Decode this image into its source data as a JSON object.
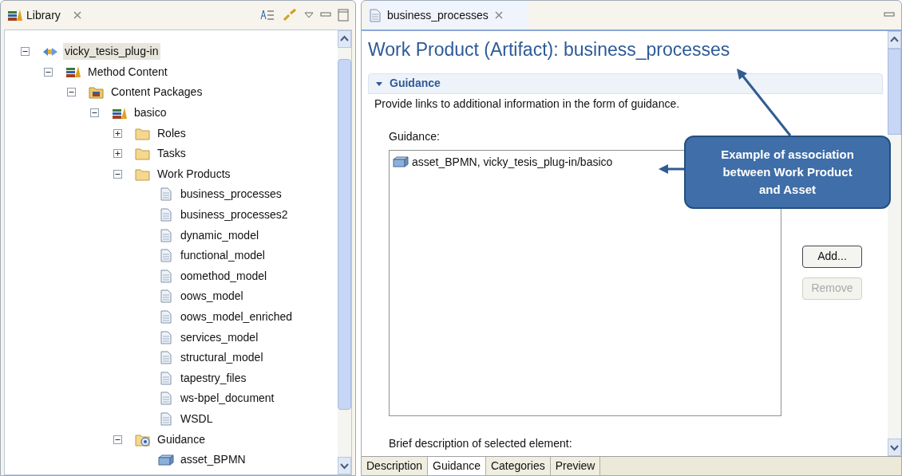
{
  "library_view": {
    "title": "Library",
    "tree": [
      {
        "label": "vicky_tesis_plug-in",
        "kind": "plugin",
        "expanded": true,
        "selected": true,
        "children": [
          {
            "label": "Method Content",
            "kind": "library",
            "expanded": true,
            "selected": false,
            "children": [
              {
                "label": "Content Packages",
                "kind": "package",
                "expanded": true,
                "selected": false,
                "children": [
                  {
                    "label": "basico",
                    "kind": "library",
                    "expanded": true,
                    "selected": false,
                    "children": [
                      {
                        "label": "Roles",
                        "kind": "folder",
                        "expanded": false,
                        "selected": false
                      },
                      {
                        "label": "Tasks",
                        "kind": "folder",
                        "expanded": false,
                        "selected": false
                      },
                      {
                        "label": "Work Products",
                        "kind": "folder",
                        "expanded": true,
                        "selected": false,
                        "children": [
                          {
                            "label": "business_processes",
                            "kind": "document",
                            "selected": false
                          },
                          {
                            "label": "business_processes2",
                            "kind": "document",
                            "selected": false
                          },
                          {
                            "label": "dynamic_model",
                            "kind": "document",
                            "selected": false
                          },
                          {
                            "label": "functional_model",
                            "kind": "document",
                            "selected": false
                          },
                          {
                            "label": "oomethod_model",
                            "kind": "document",
                            "selected": false
                          },
                          {
                            "label": "oows_model",
                            "kind": "document",
                            "selected": false
                          },
                          {
                            "label": "oows_model_enriched",
                            "kind": "document",
                            "selected": false
                          },
                          {
                            "label": "services_model",
                            "kind": "document",
                            "selected": false
                          },
                          {
                            "label": "structural_model",
                            "kind": "document",
                            "selected": false
                          },
                          {
                            "label": "tapestry_files",
                            "kind": "document",
                            "selected": false
                          },
                          {
                            "label": "ws-bpel_document",
                            "kind": "document",
                            "selected": false
                          },
                          {
                            "label": "WSDL",
                            "kind": "document",
                            "selected": false
                          }
                        ]
                      },
                      {
                        "label": "Guidance",
                        "kind": "guidance",
                        "expanded": true,
                        "selected": false,
                        "children": [
                          {
                            "label": "asset_BPMN",
                            "kind": "asset",
                            "selected": false
                          }
                        ]
                      }
                    ]
                  }
                ]
              }
            ]
          }
        ]
      }
    ]
  },
  "editor": {
    "tab": "business_processes",
    "heading": "Work Product (Artifact): business_processes",
    "section": {
      "title": "Guidance",
      "expanded": true,
      "description": "Provide links to additional information in the form of guidance.",
      "list_label": "Guidance:",
      "items": [
        "asset_BPMN, vicky_tesis_plug-in/basico"
      ],
      "buttons": [
        {
          "label": "Add...",
          "disabled": false
        },
        {
          "label": "Remove",
          "disabled": true
        }
      ],
      "brief_label": "Brief description of selected element:"
    },
    "bottom_tabs": [
      {
        "label": "Description",
        "selected": false
      },
      {
        "label": "Guidance",
        "selected": true
      },
      {
        "label": "Categories",
        "selected": false
      },
      {
        "label": "Preview",
        "selected": false
      }
    ]
  },
  "callout": {
    "text": "Example of association between Work Product and Asset"
  }
}
